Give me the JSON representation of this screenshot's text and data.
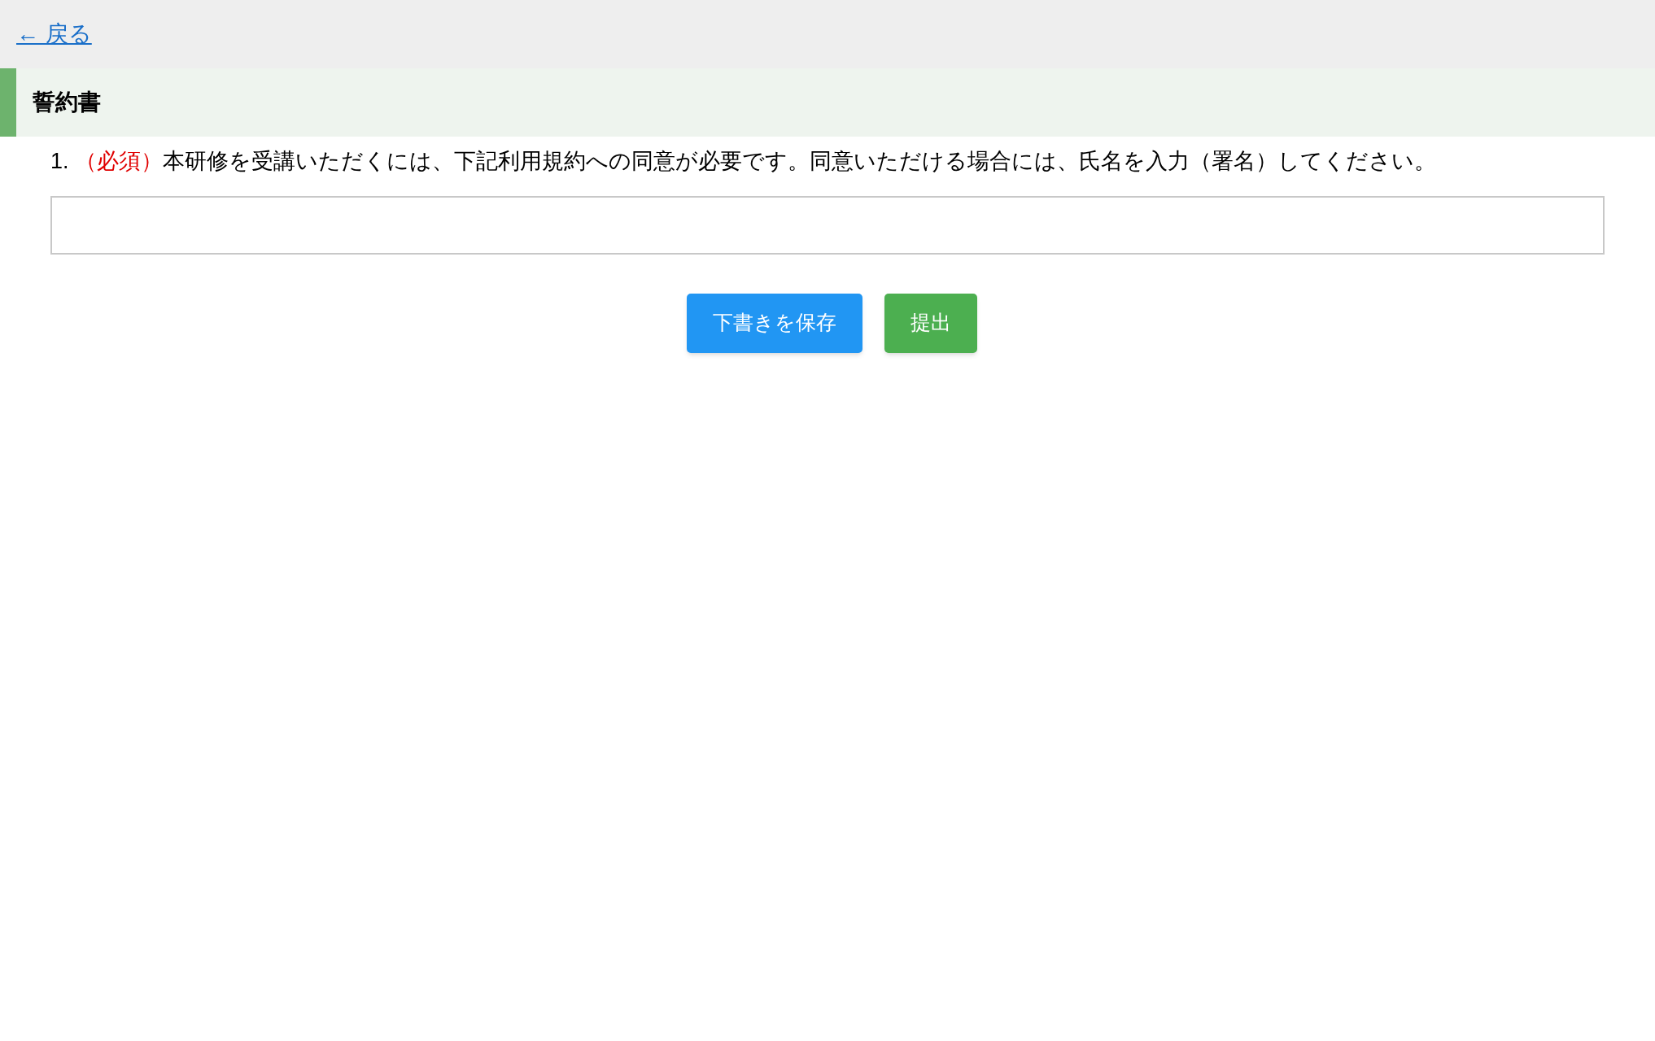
{
  "back_link": {
    "label": "← 戻る"
  },
  "section": {
    "title": "誓約書"
  },
  "questions": [
    {
      "number": "1.",
      "required_label": "（必須）",
      "text": "本研修を受講いただくには、下記利用規約への同意が必要です。同意いただける場合には、氏名を入力（署名）してください。"
    }
  ],
  "buttons": [
    {
      "label": "下書きを保存",
      "kind": "draft"
    },
    {
      "label": "提出",
      "kind": "submit"
    }
  ]
}
